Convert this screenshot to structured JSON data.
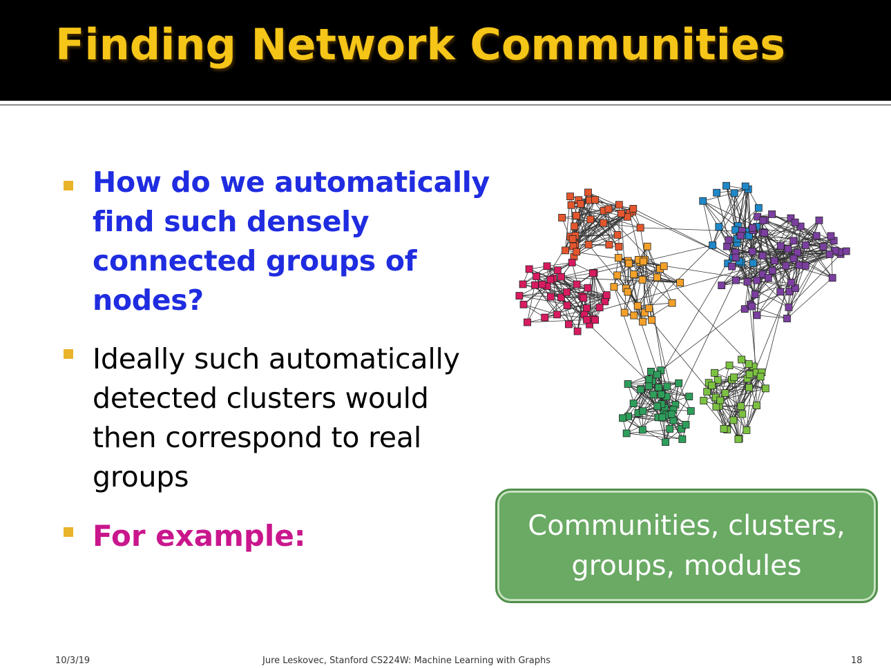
{
  "slide": {
    "title": "Finding Network Communities",
    "colors": {
      "title_bar": "#000000",
      "title_text": "#f5c518",
      "bullet_marker": "#e9b32a",
      "bullet1": "#1f2ce0",
      "bullet2": "#000000",
      "bullet3": "#c9168c",
      "callout_bg": "#6aaa64"
    },
    "bullets": [
      {
        "text": "How do we automatically find such densely connected groups of nodes?"
      },
      {
        "text": "Ideally such automatically detected clusters would then correspond to real groups"
      },
      {
        "text": "For example:"
      }
    ],
    "callout": {
      "line1": "Communities, clusters,",
      "line2": "groups, modules"
    },
    "figure": {
      "icon": "network-graph-icon",
      "communities": [
        {
          "color": "#e4572e"
        },
        {
          "color": "#d81b60"
        },
        {
          "color": "#f4a12a"
        },
        {
          "color": "#1e88c8"
        },
        {
          "color": "#7b3fa0"
        },
        {
          "color": "#2e9e5b"
        },
        {
          "color": "#7cc242"
        }
      ]
    },
    "footer": {
      "date": "10/3/19",
      "credit": "Jure Leskovec, Stanford CS224W: Machine Learning with Graphs",
      "page": "18"
    }
  }
}
